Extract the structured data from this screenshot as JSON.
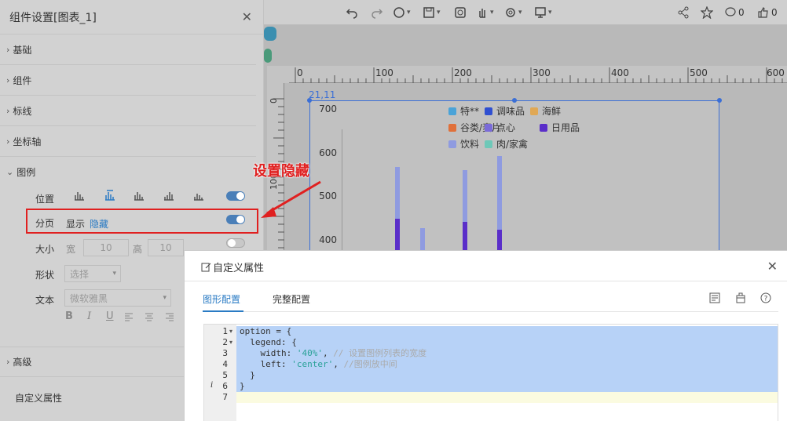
{
  "panel": {
    "title": "组件设置[图表_1]",
    "sections": {
      "basic": "基础",
      "component": "组件",
      "markline": "标线",
      "axis": "坐标轴",
      "legend": "图例",
      "advanced": "高级"
    },
    "legend_rows": {
      "position": "位置",
      "paging": "分页",
      "paging_show": "显示",
      "paging_hide": "隐藏",
      "size": "大小",
      "width_label": "宽",
      "width_value": "10",
      "height_label": "高",
      "height_value": "10",
      "shape": "形状",
      "shape_placeholder": "选择",
      "text": "文本",
      "font_value": "微软雅黑",
      "format_buttons": [
        "B",
        "I",
        "U"
      ]
    },
    "custom_props": "自定义属性"
  },
  "annotation": {
    "label": "设置隐藏",
    "color": "#e02020"
  },
  "toolbar": {
    "icons": [
      "undo-icon",
      "redo-icon",
      "refresh-icon",
      "save-icon",
      "preview-icon",
      "hand-icon",
      "gear-icon",
      "monitor-icon",
      "share-icon",
      "star-icon",
      "comment-icon",
      "like-icon"
    ],
    "comment_count": "0",
    "like_count": "0"
  },
  "ruler": {
    "h_labels": [
      "0",
      "100",
      "200",
      "300",
      "400",
      "500",
      "600"
    ],
    "v_labels": [
      "0",
      "100"
    ]
  },
  "chart": {
    "coord_label": "21,11",
    "accent": "#3b6fd6"
  },
  "chart_data": {
    "type": "bar",
    "legend": [
      {
        "name": "特**",
        "color": "#4aa3d8"
      },
      {
        "name": "调味品",
        "color": "#2f4fd1"
      },
      {
        "name": "海鲜",
        "color": "#e0a855"
      },
      {
        "name": "谷类/麦片",
        "color": "#e0703a"
      },
      {
        "name": "点心",
        "color": "#7a6bd9"
      },
      {
        "name": "日用品",
        "color": "#5a2ec9"
      },
      {
        "name": "饮料",
        "color": "#8f9be0"
      },
      {
        "name": "肉/家禽",
        "color": "#6ec8b8"
      }
    ],
    "y_ticks": [
      "700",
      "600",
      "500",
      "400"
    ],
    "ylim": [
      360,
      720
    ],
    "legend_position": "top-center"
  },
  "dialog": {
    "title": "自定义属性",
    "tabs": [
      "图形配置",
      "完整配置"
    ],
    "active_tab": 0,
    "code": [
      "option = {",
      "  legend: {",
      "    width: '40%', // 设置图例列表的宽度",
      "    left: 'center', //图例放中间",
      "  }",
      "}",
      ""
    ]
  }
}
